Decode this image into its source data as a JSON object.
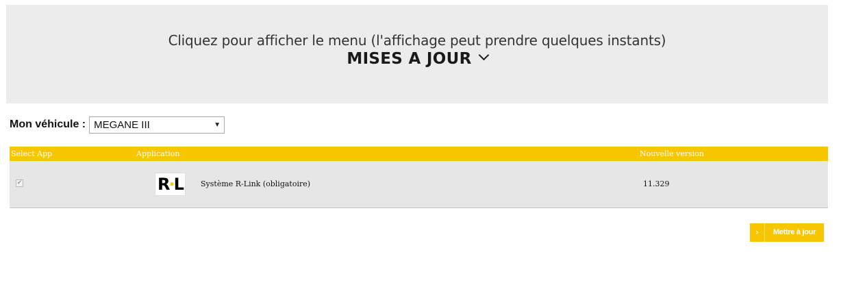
{
  "banner": {
    "hint": "Cliquez pour afficher le menu (l'affichage peut prendre quelques instants)",
    "menu_title": "MISES A JOUR",
    "menu_icon": "chevron-down-icon"
  },
  "vehicle": {
    "label": "Mon véhicule :",
    "selected": "MEGANE III"
  },
  "table": {
    "columns": [
      "Select App",
      "Application",
      "Nouvelle version"
    ],
    "rows": [
      {
        "checked": true,
        "logo_text_left": "R",
        "logo_text_dot": "·",
        "logo_text_right": "L",
        "name": "Système R-Link (obligatoire)",
        "version": "11.329"
      }
    ]
  },
  "actions": {
    "update_label": "Mettre à jour",
    "update_icon": "chevron-right-icon"
  },
  "colors": {
    "accent": "#f7c600",
    "banner_bg": "#ececec",
    "row_bg": "#e6e6e6"
  }
}
